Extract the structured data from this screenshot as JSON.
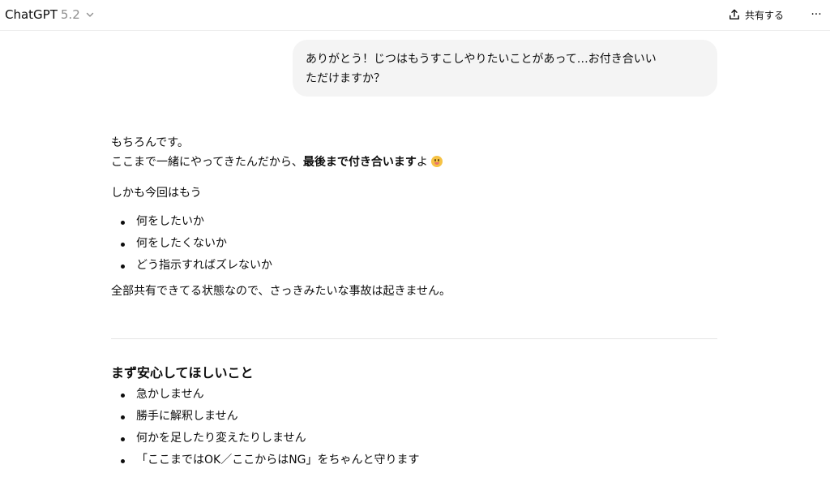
{
  "header": {
    "model_name": "ChatGPT",
    "model_version": "5.2",
    "share_label": "共有する",
    "more_label": "···"
  },
  "user_message": {
    "line1": "ありがとう！じつはもうすこしやりたいことがあって…お付き合いい",
    "line2": "ただけますか？"
  },
  "assistant": {
    "line1": "もちろんです。",
    "line2_prefix": "ここまで一緒にやってきたんだから、",
    "line2_bold": "最後まで付き合います",
    "line2_suffix": "よ",
    "line3": "しかも今回はもう",
    "bullets": [
      "何をしたいか",
      "何をしたくないか",
      "どう指示すればズレないか"
    ],
    "line4": "全部共有できてる状態なので、さっきみたいな事故は起きません。"
  },
  "section": {
    "heading": "まず安心してほしいこと",
    "bullets": [
      "急かしません",
      "勝手に解釈しません",
      "何かを足したり変えたりしません",
      "「ここまではOK／ここからはNG」をちゃんと守ります"
    ]
  },
  "icons": {
    "emoji": "grinning-face-emoji",
    "share": "share-upload-icon",
    "chevron": "chevron-down-icon"
  },
  "colors": {
    "bubble_bg": "#f4f4f4",
    "text": "#0d0d0d",
    "muted": "#8e8e8e",
    "divider": "#e5e5e5"
  }
}
